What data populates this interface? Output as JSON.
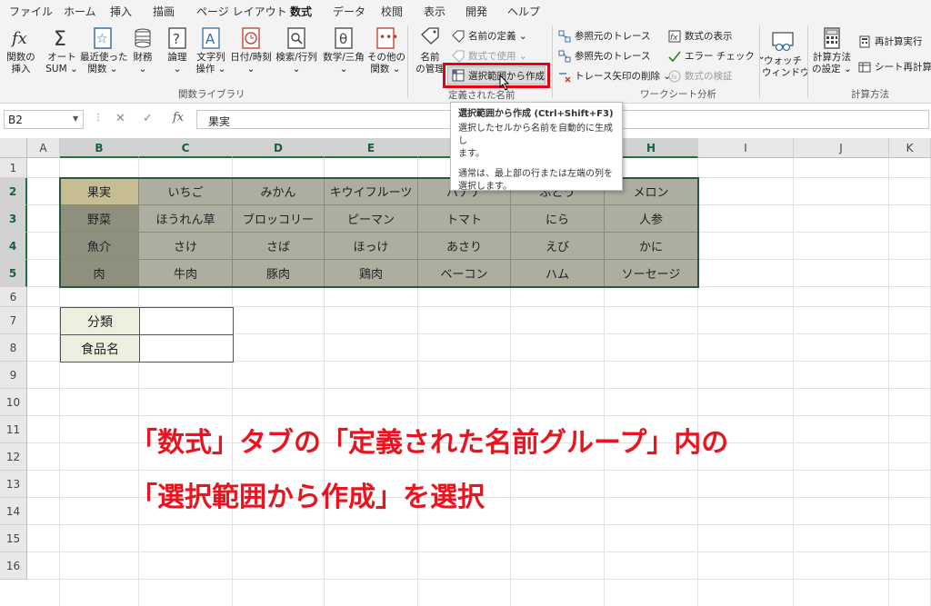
{
  "tabs": [
    "ファイル",
    "ホーム",
    "挿入",
    "描画",
    "ページ レイアウト",
    "数式",
    "データ",
    "校閲",
    "表示",
    "開発",
    "ヘルプ"
  ],
  "active_tab": "数式",
  "ribbon": {
    "function_library": {
      "insert_function": [
        "関数の",
        "挿入"
      ],
      "autosum": [
        "オート",
        "SUM ⌄"
      ],
      "recent": [
        "最近使った",
        "関数 ⌄"
      ],
      "financial": [
        "財務",
        "⌄"
      ],
      "logical": [
        "論理",
        "⌄"
      ],
      "text": [
        "文字列",
        "操作 ⌄"
      ],
      "datetime": [
        "日付/時刻",
        "⌄"
      ],
      "lookup": [
        "検索/行列",
        "⌄"
      ],
      "math": [
        "数学/三角",
        "⌄"
      ],
      "more": [
        "その他の",
        "関数 ⌄"
      ],
      "group_label": "関数ライブラリ"
    },
    "defined_names": {
      "name_manager": [
        "名前",
        "の管理"
      ],
      "define_name": "名前の定義 ⌄",
      "use_in_formula": "数式で使用 ⌄",
      "create_from_selection": "選択範囲から作成",
      "group_label": "定義された名前"
    },
    "formula_auditing": {
      "trace_precedents": "参照元のトレース",
      "trace_dependents": "参照先のトレース",
      "remove_arrows": "トレース矢印の削除 ⌄",
      "show_formulas": "数式の表示",
      "error_checking": "エラー チェック ⌄",
      "evaluate_formula": "数式の検証",
      "watch_window": [
        "ウォッチ",
        "ウィンドウ"
      ],
      "group_label": "ワークシート分析"
    },
    "calculation": {
      "calc_options": [
        "計算方法",
        "の設定 ⌄"
      ],
      "calc_now": "再計算実行",
      "calc_sheet": "シート再計算",
      "group_label": "計算方法"
    }
  },
  "tooltip": {
    "title": "選択範囲から作成 (Ctrl+Shift+F3)",
    "line1": "選択したセルから名前を自動的に生成し",
    "line2": "ます。",
    "line3": "通常は、最上部の行または左端の列を",
    "line4": "選択します。"
  },
  "formula_bar": {
    "name_box": "B2",
    "content": "果実",
    "fx": "fx"
  },
  "columns": [
    "A",
    "B",
    "C",
    "D",
    "E",
    "F",
    "G",
    "H",
    "I",
    "J",
    "K"
  ],
  "rows": [
    "1",
    "2",
    "3",
    "4",
    "5",
    "6",
    "7",
    "8",
    "9",
    "10",
    "11",
    "12",
    "13",
    "14",
    "15",
    "16"
  ],
  "table": [
    [
      "果実",
      "いちご",
      "みかん",
      "キウイフルーツ",
      "バナナ",
      "ぶどう",
      "メロン"
    ],
    [
      "野菜",
      "ほうれん草",
      "ブロッコリー",
      "ピーマン",
      "トマト",
      "にら",
      "人参"
    ],
    [
      "魚介",
      "さけ",
      "さば",
      "ほっけ",
      "あさり",
      "えび",
      "かに"
    ],
    [
      "肉",
      "牛肉",
      "豚肉",
      "鶏肉",
      "ベーコン",
      "ハム",
      "ソーセージ"
    ]
  ],
  "inputs": {
    "category_label": "分類",
    "food_label": "食品名"
  },
  "caption": {
    "line1": "「数式」タブの「定義された名前グループ」内の",
    "line2": "「選択範囲から作成」を選択"
  },
  "colors": {
    "accent": "#217346",
    "caption": "#e8141f",
    "highlight": "#e60012",
    "header_cell": "#8f8f7d",
    "body_cell": "#adada0",
    "active_cell": "#c6bd92",
    "label_fill": "#ebf1de"
  }
}
